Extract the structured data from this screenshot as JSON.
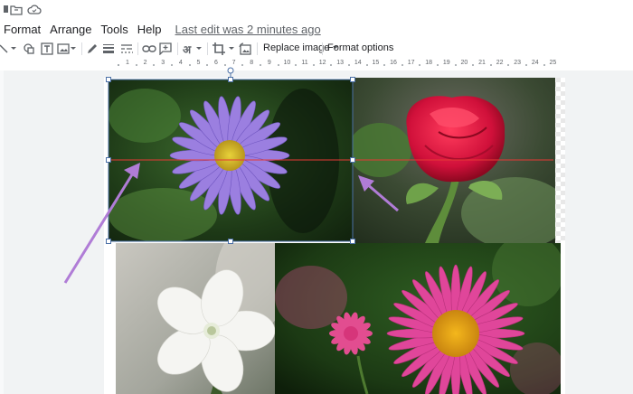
{
  "menu": {
    "items": [
      "Format",
      "Arrange",
      "Tools",
      "Help"
    ],
    "last_edit": "Last edit was 2 minutes ago"
  },
  "toolbar": {
    "replace_image_label": "Replace image",
    "format_options_label": "Format options"
  },
  "ruler": {
    "numbers": [
      "1",
      "2",
      "3",
      "4",
      "5",
      "6",
      "7",
      "8",
      "9",
      "10",
      "11",
      "12",
      "13",
      "14",
      "15",
      "16",
      "17",
      "18",
      "19",
      "20",
      "21",
      "22",
      "23",
      "24",
      "25"
    ]
  },
  "slide": {
    "images": [
      {
        "subject": "purple-daisy",
        "selected": true
      },
      {
        "subject": "red-rose"
      },
      {
        "subject": "white-flower"
      },
      {
        "subject": "pink-daisy"
      }
    ],
    "annotation_color": "#b07cd6",
    "guide_color": "#e53935",
    "selection_color": "#4a6fa5"
  },
  "icons": [
    "folder-icon",
    "cloud-icon",
    "line-icon",
    "shape-icon",
    "textbox-icon",
    "image-icon",
    "pen-icon",
    "line-weight-icon",
    "line-dash-icon",
    "link-icon",
    "comment-icon",
    "text-format-icon",
    "crop-icon",
    "reset-image-icon"
  ]
}
